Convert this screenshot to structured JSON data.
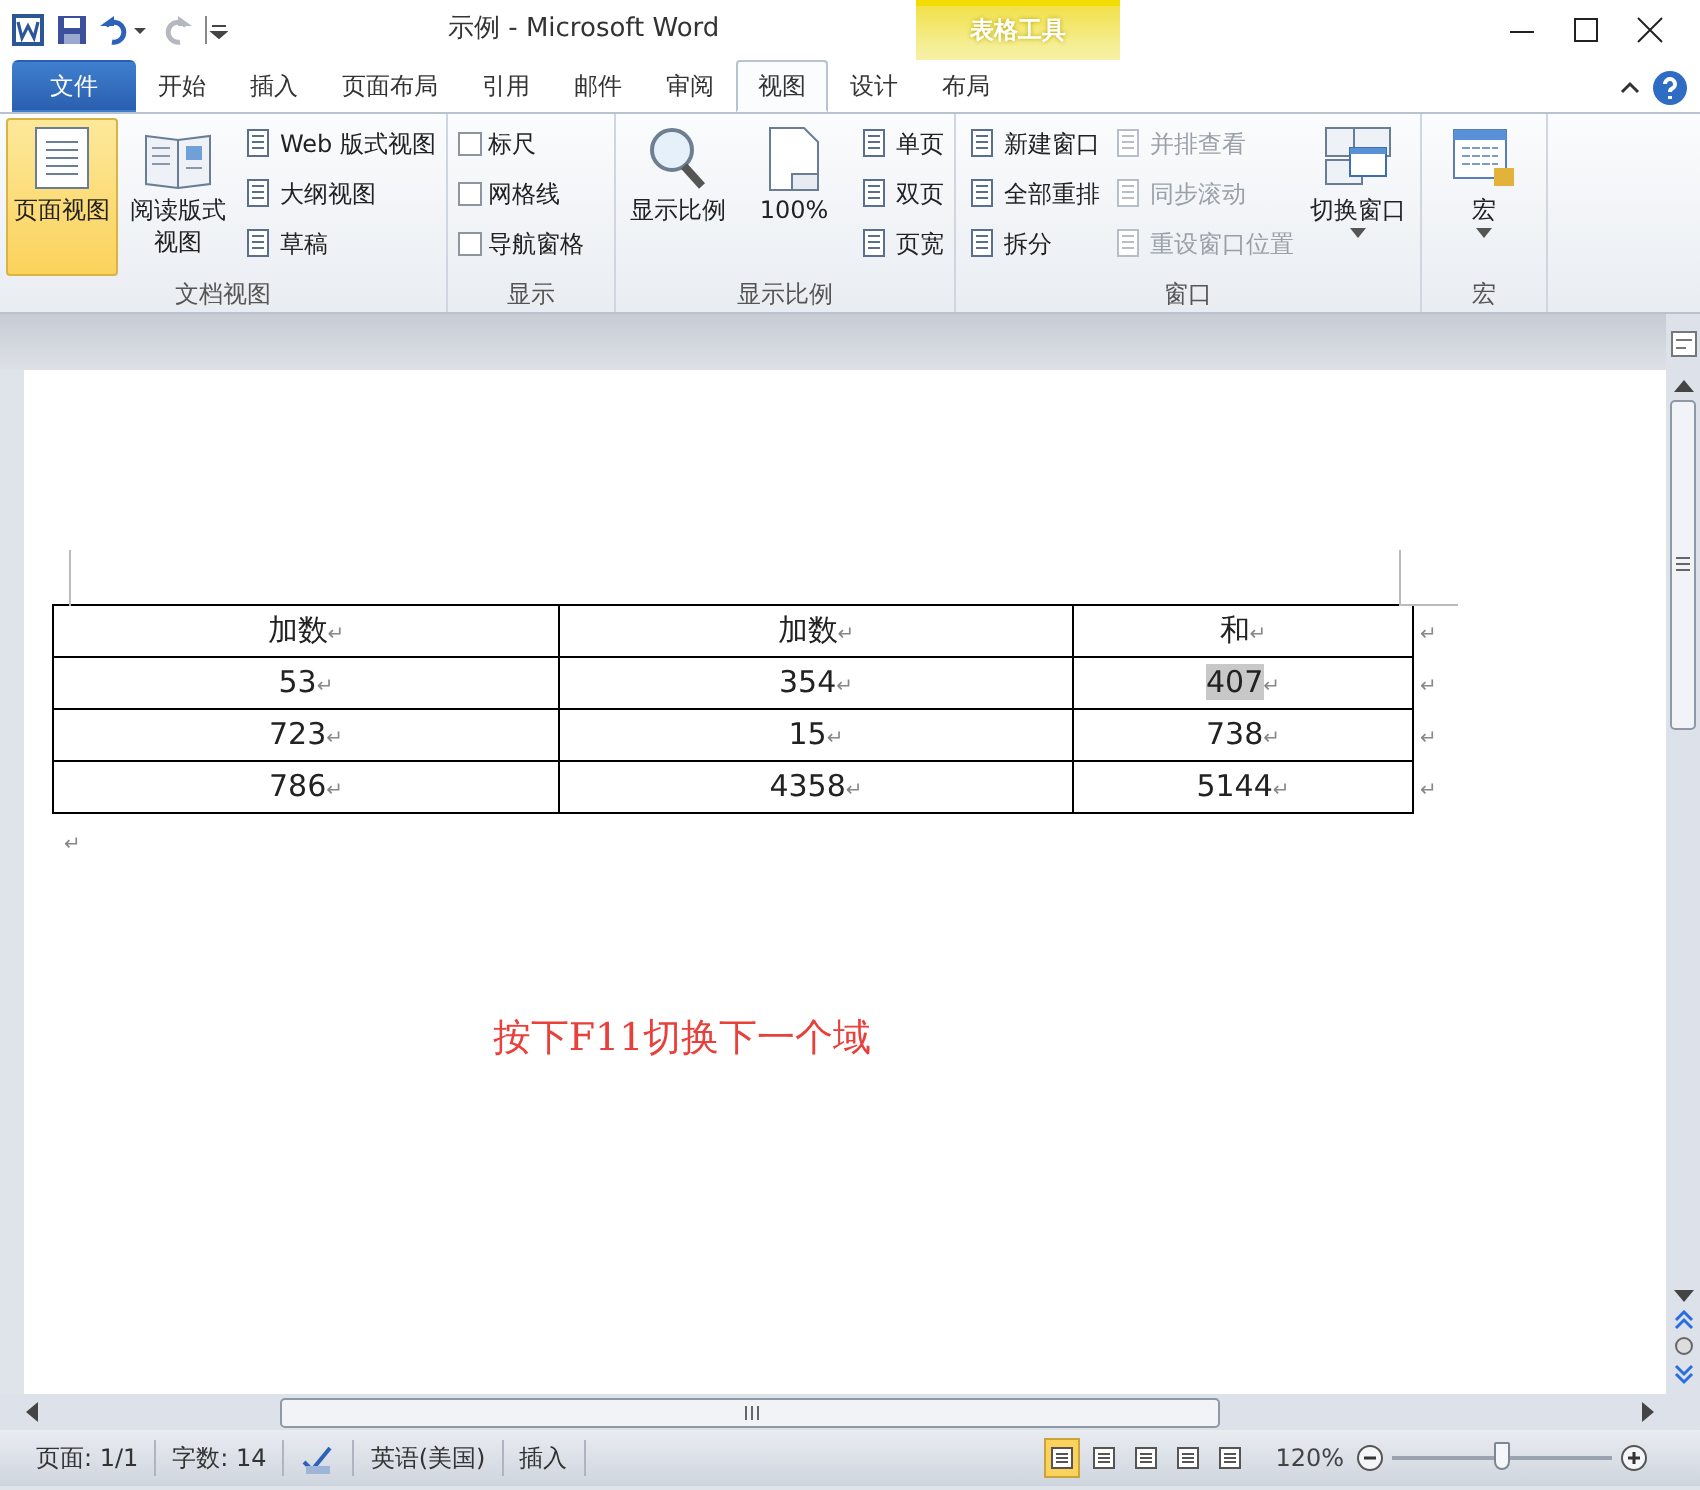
{
  "title_bar": {
    "title": "示例  -  Microsoft Word",
    "context_group": "表格工具"
  },
  "tabs": [
    {
      "label": "文件",
      "kind": "file",
      "selected": false
    },
    {
      "label": "开始",
      "kind": "normal",
      "selected": false
    },
    {
      "label": "插入",
      "kind": "normal",
      "selected": false
    },
    {
      "label": "页面布局",
      "kind": "normal",
      "selected": false
    },
    {
      "label": "引用",
      "kind": "normal",
      "selected": false
    },
    {
      "label": "邮件",
      "kind": "normal",
      "selected": false
    },
    {
      "label": "审阅",
      "kind": "normal",
      "selected": false
    },
    {
      "label": "视图",
      "kind": "normal",
      "selected": true
    },
    {
      "label": "设计",
      "kind": "context",
      "selected": false
    },
    {
      "label": "布局",
      "kind": "context",
      "selected": false
    }
  ],
  "ribbon": [
    {
      "label": "文档视图",
      "items": [
        {
          "kind": "large",
          "label": "页面视图",
          "selected": true,
          "dropdown": false
        },
        {
          "kind": "large",
          "label": "阅读版式视图",
          "selected": false,
          "dropdown": false
        },
        {
          "kind": "small",
          "label": "Web 版式视图",
          "disabled": false
        },
        {
          "kind": "small",
          "label": "大纲视图",
          "disabled": false
        },
        {
          "kind": "small",
          "label": "草稿",
          "disabled": false
        }
      ]
    },
    {
      "label": "显示",
      "items": [
        {
          "kind": "check",
          "label": "标尺",
          "checked": false
        },
        {
          "kind": "check",
          "label": "网格线",
          "checked": false
        },
        {
          "kind": "check",
          "label": "导航窗格",
          "checked": false
        }
      ]
    },
    {
      "label": "显示比例",
      "items": [
        {
          "kind": "large",
          "label": "显示比例",
          "selected": false,
          "dropdown": false
        },
        {
          "kind": "large",
          "label": "100%",
          "selected": false,
          "dropdown": false
        },
        {
          "kind": "small",
          "label": "单页",
          "disabled": false
        },
        {
          "kind": "small",
          "label": "双页",
          "disabled": false
        },
        {
          "kind": "small",
          "label": "页宽",
          "disabled": false
        }
      ]
    },
    {
      "label": "窗口",
      "items": [
        {
          "kind": "small",
          "label": "新建窗口",
          "disabled": false
        },
        {
          "kind": "small",
          "label": "全部重排",
          "disabled": false
        },
        {
          "kind": "small",
          "label": "拆分",
          "disabled": false
        },
        {
          "kind": "small",
          "label": "并排查看",
          "disabled": true
        },
        {
          "kind": "small",
          "label": "同步滚动",
          "disabled": true
        },
        {
          "kind": "small",
          "label": "重设窗口位置",
          "disabled": true
        },
        {
          "kind": "large",
          "label": "切换窗口",
          "selected": false,
          "dropdown": true
        }
      ]
    },
    {
      "label": "宏",
      "items": [
        {
          "kind": "large",
          "label": "宏",
          "selected": false,
          "dropdown": true
        }
      ]
    }
  ],
  "table": {
    "rows": [
      {
        "end_mark": "↵",
        "cells": [
          {
            "text": "加数",
            "mark": "↵",
            "highlighted": false
          },
          {
            "text": "加数",
            "mark": "↵",
            "highlighted": false
          },
          {
            "text": "和",
            "mark": "↵",
            "highlighted": false
          }
        ]
      },
      {
        "end_mark": "↵",
        "cells": [
          {
            "text": "53",
            "mark": "↵",
            "highlighted": false
          },
          {
            "text": "354",
            "mark": "↵",
            "highlighted": false
          },
          {
            "text": "407",
            "mark": "↵",
            "highlighted": true
          }
        ]
      },
      {
        "end_mark": "↵",
        "cells": [
          {
            "text": "723",
            "mark": "↵",
            "highlighted": false
          },
          {
            "text": "15",
            "mark": "↵",
            "highlighted": false
          },
          {
            "text": "738",
            "mark": "↵",
            "highlighted": false
          }
        ]
      },
      {
        "end_mark": "↵",
        "cells": [
          {
            "text": "786",
            "mark": "↵",
            "highlighted": false
          },
          {
            "text": "4358",
            "mark": "↵",
            "highlighted": false
          },
          {
            "text": "5144",
            "mark": "↵",
            "highlighted": false
          }
        ]
      }
    ]
  },
  "after_table_mark": "↵",
  "note": {
    "text": "按下F11切换下一个域",
    "color": "#e8413c"
  },
  "status_bar": {
    "page": "页面: 1/1",
    "words": "字数: 14",
    "language": "英语(美国)",
    "mode": "插入",
    "view_buttons": [
      {
        "selected": true
      },
      {
        "selected": false
      },
      {
        "selected": false
      },
      {
        "selected": false
      },
      {
        "selected": false
      }
    ],
    "zoom": "120%",
    "zoom_level": {
      "level": 0.5
    }
  }
}
